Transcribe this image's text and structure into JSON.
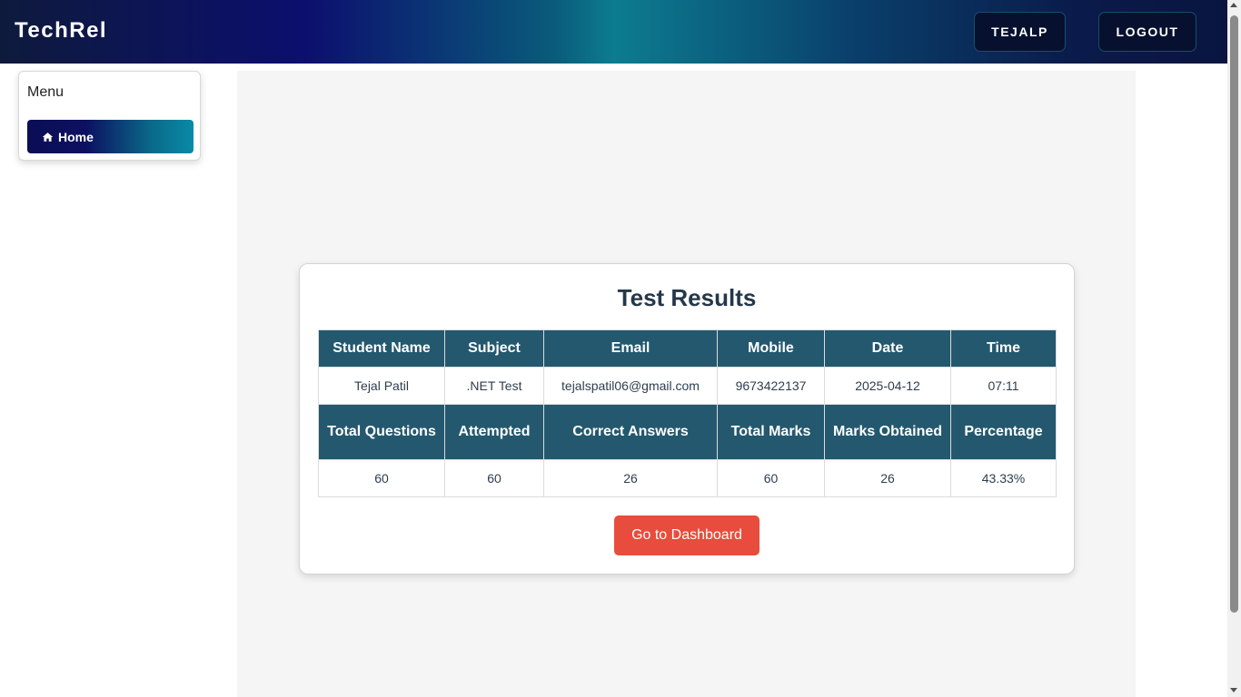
{
  "header": {
    "brand": "TechRel",
    "user_label": "TEJALP",
    "logout_label": "LOGOUT"
  },
  "sidebar": {
    "title": "Menu",
    "items": [
      {
        "label": "Home",
        "icon": "home-icon"
      }
    ]
  },
  "results": {
    "title": "Test Results",
    "row1_headers": [
      "Student Name",
      "Subject",
      "Email",
      "Mobile",
      "Date",
      "Time"
    ],
    "row1_values": [
      "Tejal Patil",
      ".NET Test",
      "tejalspatil06@gmail.com",
      "9673422137",
      "2025-04-12",
      "07:11"
    ],
    "row2_headers": [
      "Total Questions",
      "Attempted",
      "Correct Answers",
      "Total Marks",
      "Marks Obtained",
      "Percentage"
    ],
    "row2_values": [
      "60",
      "60",
      "26",
      "60",
      "26",
      "43.33%"
    ],
    "dashboard_button": "Go to Dashboard"
  },
  "colors": {
    "table_header": "#24586e",
    "dashboard_button": "#e84c3d",
    "title_text": "#24384a"
  }
}
